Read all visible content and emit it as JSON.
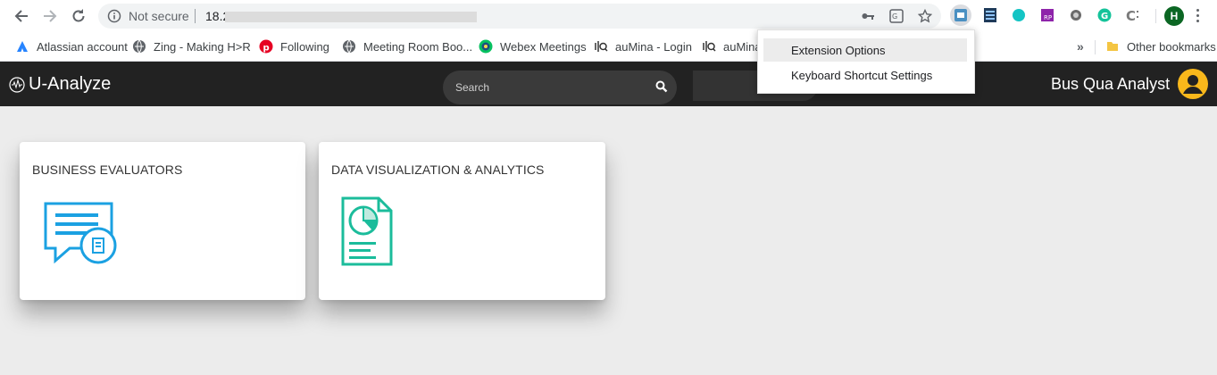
{
  "browser": {
    "address": {
      "security_label": "Not secure",
      "url": "18.2"
    }
  },
  "bookmarks": {
    "items": [
      {
        "label": "Atlassian account",
        "icon": "atlassian-icon"
      },
      {
        "label": "Zing - Making H>R",
        "icon": "globe-icon"
      },
      {
        "label": "Following",
        "icon": "pinterest-icon"
      },
      {
        "label": "Meeting Room Boo...",
        "icon": "globe-icon"
      },
      {
        "label": "Webex Meetings",
        "icon": "webex-icon"
      },
      {
        "label": "auMina - Login",
        "icon": "aumina-icon"
      },
      {
        "label": "auMina",
        "icon": "aumina-icon"
      }
    ],
    "more_label": "»",
    "other_label": "Other bookmarks"
  },
  "profile": {
    "initial": "H"
  },
  "context_menu": {
    "items": [
      "Extension Options",
      "Keyboard Shortcut Settings"
    ]
  },
  "app": {
    "logo_text": "U-Analyze",
    "search_placeholder": "Search",
    "user_role": "Bus Qua Analyst"
  },
  "cards": [
    {
      "title": "BUSINESS EVALUATORS",
      "icon": "chat-document-icon"
    },
    {
      "title": "DATA VISUALIZATION & ANALYTICS",
      "icon": "pie-chart-document-icon"
    }
  ],
  "colors": {
    "header_bg": "#222222",
    "accent_blue": "#1ba1e2",
    "accent_green": "#1bbc9b",
    "avatar_yellow": "#f9b81b"
  }
}
